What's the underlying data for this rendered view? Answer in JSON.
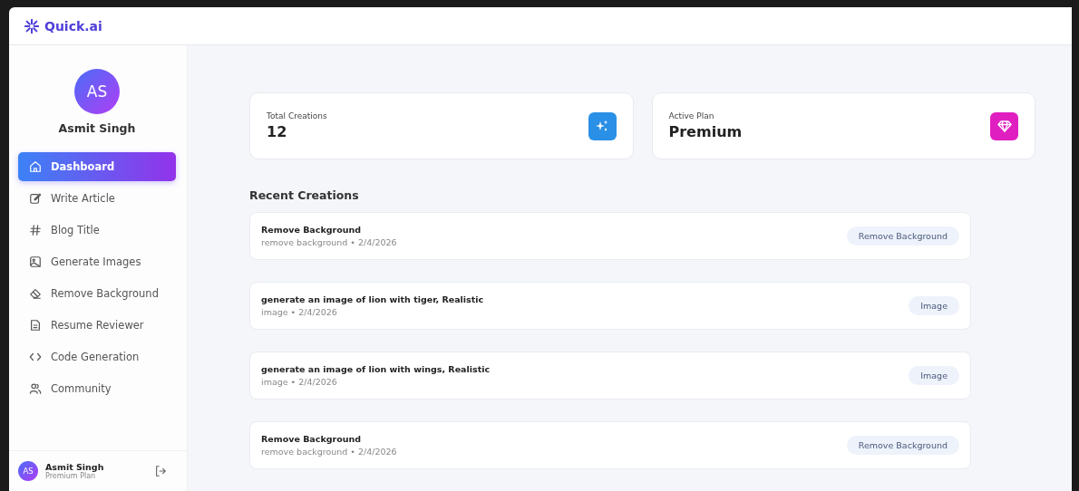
{
  "brand": {
    "name": "Quick.ai"
  },
  "profile": {
    "initials": "AS",
    "name": "Asmit Singh"
  },
  "nav": [
    {
      "label": "Dashboard",
      "selected": true
    },
    {
      "label": "Write Article",
      "selected": false
    },
    {
      "label": "Blog Title",
      "selected": false
    },
    {
      "label": "Generate Images",
      "selected": false
    },
    {
      "label": "Remove Background",
      "selected": false
    },
    {
      "label": "Resume Reviewer",
      "selected": false
    },
    {
      "label": "Code Generation",
      "selected": false
    },
    {
      "label": "Community",
      "selected": false
    }
  ],
  "footer_user": {
    "initials": "AS",
    "name": "Asmit Singh",
    "plan": "Premium Plan"
  },
  "stats": [
    {
      "label": "Total Creations",
      "value": "12",
      "color": "#2a8fe6"
    },
    {
      "label": "Active Plan",
      "value": "Premium",
      "color": "#e01fc0"
    }
  ],
  "recent": {
    "title": "Recent Creations",
    "items": [
      {
        "title": "Remove Background",
        "meta": "remove background • 2/4/2026",
        "badge": "Remove Background"
      },
      {
        "title": "generate an image of lion with tiger, Realistic",
        "meta": "image • 2/4/2026",
        "badge": "Image"
      },
      {
        "title": "generate an image of lion with wings, Realistic",
        "meta": "image • 2/4/2026",
        "badge": "Image"
      },
      {
        "title": "Remove Background",
        "meta": "remove background • 2/4/2026",
        "badge": "Remove Background"
      }
    ]
  }
}
